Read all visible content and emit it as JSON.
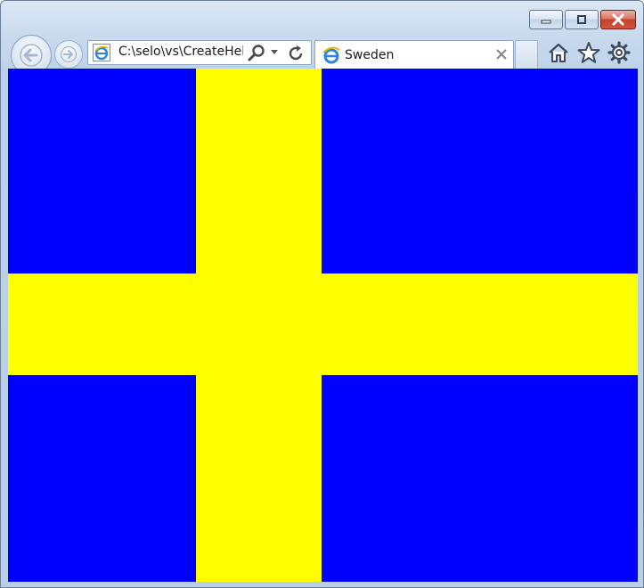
{
  "window": {
    "caption_buttons": [
      "minimize",
      "maximize",
      "close"
    ]
  },
  "navigation": {
    "back_icon": "arrow-left-icon",
    "forward_icon": "arrow-right-icon"
  },
  "address_bar": {
    "value": "C:\\selo\\vs\\CreateHel",
    "favicon": "ie-logo-icon",
    "search_icon": "search-icon",
    "dropdown_icon": "chevron-down-icon",
    "refresh_icon": "refresh-icon"
  },
  "tab": {
    "title": "Sweden",
    "favicon": "ie-logo-icon",
    "close_icon": "close-icon"
  },
  "toolbar": {
    "icons": [
      "home-icon",
      "favorites-star-icon",
      "settings-gear-icon"
    ]
  },
  "page": {
    "flag": {
      "colors": {
        "field": "#0000ff",
        "cross": "#ffff00"
      }
    }
  }
}
